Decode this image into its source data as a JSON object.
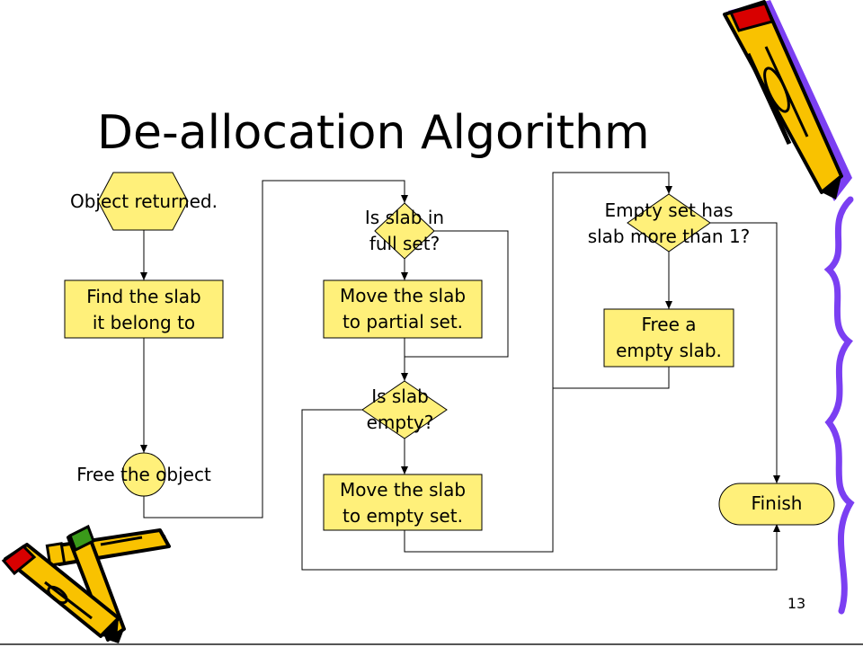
{
  "title": "De-allocation Algorithm",
  "page_number": "13",
  "colors": {
    "node_fill": "#FFF07A",
    "line": "#000000",
    "pencil_body": "#F9C200",
    "pencil_shadow": "#7B3FF2",
    "pencil_tip": "#D80000",
    "pencil_green": "#3A9A1A"
  },
  "nodes": {
    "start": {
      "label": "Object returned."
    },
    "find_slab": {
      "line1": "Find the slab",
      "line2": "it belong to"
    },
    "free_object": {
      "label": "Free the object"
    },
    "is_full": {
      "line1": "Is slab in",
      "line2": "full set?"
    },
    "move_partial": {
      "line1": "Move the slab",
      "line2": "to partial set."
    },
    "is_empty": {
      "line1": "Is slab",
      "line2": "empty?"
    },
    "move_empty": {
      "line1": "Move the slab",
      "line2": "to empty set."
    },
    "empty_set_check": {
      "line1": "Empty set has",
      "line2": "slab more than 1?"
    },
    "free_empty": {
      "line1": "Free a",
      "line2": "empty slab."
    },
    "finish": {
      "label": "Finish"
    }
  },
  "decorations": [
    "pencil-top-right-icon",
    "squiggle-right-edge-icon",
    "pencils-bottom-left-icon"
  ]
}
